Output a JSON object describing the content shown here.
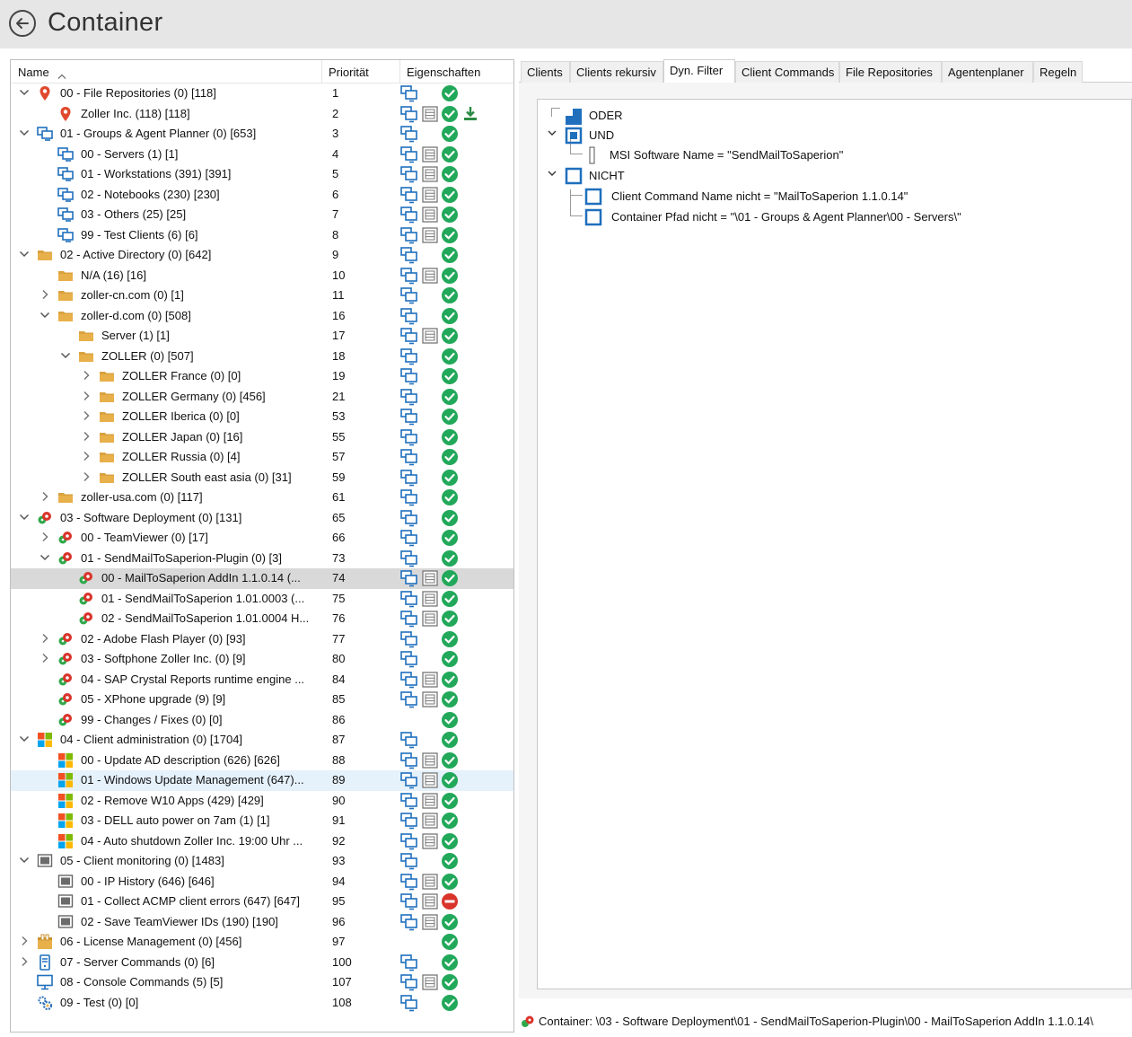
{
  "header": {
    "title": "Container"
  },
  "columns": {
    "name": "Name",
    "priority": "Priorität",
    "properties": "Eigenschaften"
  },
  "rows": [
    {
      "level": 0,
      "chev": "down",
      "icon": "pin",
      "label": "00 - File Repositories (0) [118]",
      "prio": "1",
      "props": [
        "client",
        "check"
      ]
    },
    {
      "level": 1,
      "chev": "",
      "icon": "pin",
      "label": "Zoller Inc. (118) [118]",
      "prio": "2",
      "props": [
        "client",
        "grid",
        "check",
        "download"
      ]
    },
    {
      "level": 0,
      "chev": "down",
      "icon": "group",
      "label": "01 - Groups & Agent Planner (0) [653]",
      "prio": "3",
      "props": [
        "client",
        "check"
      ]
    },
    {
      "level": 1,
      "chev": "",
      "icon": "group",
      "label": "00 - Servers (1) [1]",
      "prio": "4",
      "props": [
        "client",
        "grid",
        "check"
      ]
    },
    {
      "level": 1,
      "chev": "",
      "icon": "group",
      "label": "01 - Workstations (391) [391]",
      "prio": "5",
      "props": [
        "client",
        "grid",
        "check"
      ]
    },
    {
      "level": 1,
      "chev": "",
      "icon": "group",
      "label": "02 - Notebooks (230) [230]",
      "prio": "6",
      "props": [
        "client",
        "grid",
        "check"
      ]
    },
    {
      "level": 1,
      "chev": "",
      "icon": "group",
      "label": "03 - Others (25) [25]",
      "prio": "7",
      "props": [
        "client",
        "grid",
        "check"
      ]
    },
    {
      "level": 1,
      "chev": "",
      "icon": "group",
      "label": "99 - Test Clients (6) [6]",
      "prio": "8",
      "props": [
        "client",
        "grid",
        "check"
      ]
    },
    {
      "level": 0,
      "chev": "down",
      "icon": "folder",
      "label": "02 - Active Directory (0) [642]",
      "prio": "9",
      "props": [
        "client",
        "check"
      ]
    },
    {
      "level": 1,
      "chev": "",
      "icon": "folder",
      "label": "N/A (16) [16]",
      "prio": "10",
      "props": [
        "client",
        "grid",
        "check"
      ]
    },
    {
      "level": 1,
      "chev": "right",
      "icon": "folder",
      "label": "zoller-cn.com (0) [1]",
      "prio": "11",
      "props": [
        "client",
        "check"
      ]
    },
    {
      "level": 1,
      "chev": "down",
      "icon": "folder",
      "label": "zoller-d.com (0) [508]",
      "prio": "16",
      "props": [
        "client",
        "check"
      ]
    },
    {
      "level": 2,
      "chev": "",
      "icon": "folder",
      "label": "Server (1) [1]",
      "prio": "17",
      "props": [
        "client",
        "grid",
        "check"
      ]
    },
    {
      "level": 2,
      "chev": "down",
      "icon": "folder",
      "label": "ZOLLER (0) [507]",
      "prio": "18",
      "props": [
        "client",
        "check"
      ]
    },
    {
      "level": 3,
      "chev": "right",
      "icon": "folder",
      "label": "ZOLLER France (0) [0]",
      "prio": "19",
      "props": [
        "client",
        "check"
      ]
    },
    {
      "level": 3,
      "chev": "right",
      "icon": "folder",
      "label": "ZOLLER Germany (0) [456]",
      "prio": "21",
      "props": [
        "client",
        "check"
      ]
    },
    {
      "level": 3,
      "chev": "right",
      "icon": "folder",
      "label": "ZOLLER Iberica (0) [0]",
      "prio": "53",
      "props": [
        "client",
        "check"
      ]
    },
    {
      "level": 3,
      "chev": "right",
      "icon": "folder",
      "label": "ZOLLER Japan (0) [16]",
      "prio": "55",
      "props": [
        "client",
        "check"
      ]
    },
    {
      "level": 3,
      "chev": "right",
      "icon": "folder",
      "label": "ZOLLER Russia (0) [4]",
      "prio": "57",
      "props": [
        "client",
        "check"
      ]
    },
    {
      "level": 3,
      "chev": "right",
      "icon": "folder",
      "label": "ZOLLER South east asia (0) [31]",
      "prio": "59",
      "props": [
        "client",
        "check"
      ]
    },
    {
      "level": 1,
      "chev": "right",
      "icon": "folder",
      "label": "zoller-usa.com (0) [117]",
      "prio": "61",
      "props": [
        "client",
        "check"
      ]
    },
    {
      "level": 0,
      "chev": "down",
      "icon": "bug",
      "label": "03 - Software Deployment (0) [131]",
      "prio": "65",
      "props": [
        "client",
        "check"
      ]
    },
    {
      "level": 1,
      "chev": "right",
      "icon": "bug",
      "label": "00 - TeamViewer (0) [17]",
      "prio": "66",
      "props": [
        "client",
        "check"
      ]
    },
    {
      "level": 1,
      "chev": "down",
      "icon": "bug",
      "label": "01 - SendMailToSaperion-Plugin (0) [3]",
      "prio": "73",
      "props": [
        "client",
        "check"
      ]
    },
    {
      "level": 2,
      "chev": "",
      "icon": "bug",
      "label": "00 - MailToSaperion AddIn 1.1.0.14 (...",
      "prio": "74",
      "props": [
        "client",
        "grid",
        "check"
      ],
      "state": "selected"
    },
    {
      "level": 2,
      "chev": "",
      "icon": "bug",
      "label": "01 - SendMailToSaperion 1.01.0003 (...",
      "prio": "75",
      "props": [
        "client",
        "grid",
        "check"
      ]
    },
    {
      "level": 2,
      "chev": "",
      "icon": "bug",
      "label": "02 - SendMailToSaperion 1.01.0004 H...",
      "prio": "76",
      "props": [
        "client",
        "grid",
        "check"
      ]
    },
    {
      "level": 1,
      "chev": "right",
      "icon": "bug",
      "label": "02 - Adobe Flash Player (0) [93]",
      "prio": "77",
      "props": [
        "client",
        "check"
      ]
    },
    {
      "level": 1,
      "chev": "right",
      "icon": "bug",
      "label": "03 - Softphone Zoller Inc. (0) [9]",
      "prio": "80",
      "props": [
        "client",
        "check"
      ]
    },
    {
      "level": 1,
      "chev": "",
      "icon": "bug",
      "label": "04 - SAP Crystal Reports runtime engine ...",
      "prio": "84",
      "props": [
        "client",
        "grid",
        "check"
      ]
    },
    {
      "level": 1,
      "chev": "",
      "icon": "bug",
      "label": "05 - XPhone upgrade (9) [9]",
      "prio": "85",
      "props": [
        "client",
        "grid",
        "check"
      ]
    },
    {
      "level": 1,
      "chev": "",
      "icon": "bug",
      "label": "99 - Changes / Fixes (0) [0]",
      "prio": "86",
      "props": [
        "check"
      ]
    },
    {
      "level": 0,
      "chev": "down",
      "icon": "windows",
      "label": "04 - Client administration (0) [1704]",
      "prio": "87",
      "props": [
        "client",
        "check"
      ]
    },
    {
      "level": 1,
      "chev": "",
      "icon": "windows",
      "label": "00 - Update AD description (626) [626]",
      "prio": "88",
      "props": [
        "client",
        "grid",
        "check"
      ]
    },
    {
      "level": 1,
      "chev": "",
      "icon": "windows",
      "label": "01 - Windows Update Management (647)...",
      "prio": "89",
      "props": [
        "client",
        "grid",
        "check"
      ],
      "state": "hover"
    },
    {
      "level": 1,
      "chev": "",
      "icon": "windows",
      "label": "02 - Remove W10 Apps (429) [429]",
      "prio": "90",
      "props": [
        "client",
        "grid",
        "check"
      ]
    },
    {
      "level": 1,
      "chev": "",
      "icon": "windows",
      "label": "03 - DELL auto power on 7am (1) [1]",
      "prio": "91",
      "props": [
        "client",
        "grid",
        "check"
      ]
    },
    {
      "level": 1,
      "chev": "",
      "icon": "windows",
      "label": "04 - Auto shutdown Zoller Inc. 19:00 Uhr ...",
      "prio": "92",
      "props": [
        "client",
        "grid",
        "check"
      ]
    },
    {
      "level": 0,
      "chev": "down",
      "icon": "monitor",
      "label": "05 - Client monitoring (0) [1483]",
      "prio": "93",
      "props": [
        "client",
        "check"
      ]
    },
    {
      "level": 1,
      "chev": "",
      "icon": "monitor",
      "label": "00 - IP History (646) [646]",
      "prio": "94",
      "props": [
        "client",
        "grid",
        "check"
      ]
    },
    {
      "level": 1,
      "chev": "",
      "icon": "monitor",
      "label": "01 - Collect ACMP client errors (647) [647]",
      "prio": "95",
      "props": [
        "client",
        "grid",
        "stop"
      ]
    },
    {
      "level": 1,
      "chev": "",
      "icon": "monitor",
      "label": "02 - Save TeamViewer IDs (190) [190]",
      "prio": "96",
      "props": [
        "client",
        "grid",
        "check"
      ]
    },
    {
      "level": 0,
      "chev": "right",
      "icon": "license",
      "label": "06 - License Management (0) [456]",
      "prio": "97",
      "props": [
        "check"
      ]
    },
    {
      "level": 0,
      "chev": "right",
      "icon": "server",
      "label": "07 - Server Commands (0) [6]",
      "prio": "100",
      "props": [
        "client",
        "check"
      ]
    },
    {
      "level": 0,
      "chev": "",
      "icon": "console",
      "label": "08 - Console Commands (5) [5]",
      "prio": "107",
      "props": [
        "client",
        "grid",
        "check"
      ]
    },
    {
      "level": 0,
      "chev": "",
      "icon": "gears",
      "label": "09 - Test (0) [0]",
      "prio": "108",
      "props": [
        "client",
        "check"
      ]
    }
  ],
  "tabs": [
    "Clients",
    "Clients rekursiv",
    "Dyn. Filter",
    "Client Commands",
    "File Repositories",
    "Agentenplaner",
    "Regeln"
  ],
  "active_tab": "Dyn. Filter",
  "filter": {
    "oder": "ODER",
    "und": "UND",
    "msi_condition": "MSI Software Name =  \"SendMailToSaperion\"",
    "nicht": "NICHT",
    "cc_condition": "Client Command Name nicht =  \"MailToSaperion 1.1.0.14\"",
    "path_condition": "Container Pfad nicht =  \"\\01 - Groups & Agent Planner\\00 - Servers\\\""
  },
  "status": {
    "text": "Container: \\03 - Software Deployment\\01 - SendMailToSaperion-Plugin\\00 - MailToSaperion AddIn 1.1.0.14\\"
  },
  "colors": {
    "accent": "#1f6fbd",
    "check": "#22a85a",
    "stop": "#d9342b",
    "folder": "#e8b04a",
    "selected": "#d9d9d9",
    "hover": "#e5f1fb"
  }
}
